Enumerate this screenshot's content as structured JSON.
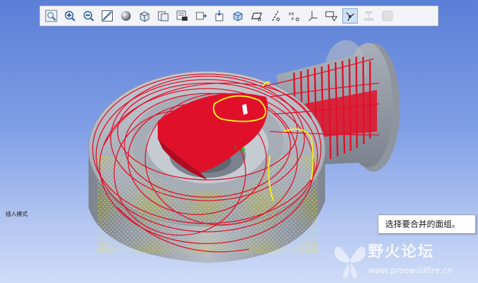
{
  "toolbar": {
    "buttons": [
      {
        "icon": "zoom-window-icon"
      },
      {
        "icon": "zoom-in-icon"
      },
      {
        "icon": "zoom-out-icon"
      },
      {
        "icon": "refit-icon"
      },
      {
        "icon": "shaded-sphere-icon"
      },
      {
        "icon": "view-cube-icon"
      },
      {
        "icon": "saved-views-icon"
      },
      {
        "icon": "layers-icon"
      },
      {
        "icon": "reorient-icon"
      },
      {
        "icon": "spin-center-icon"
      },
      {
        "icon": "display-style-icon"
      },
      {
        "icon": "datum-plane-icon"
      },
      {
        "icon": "datum-axis-icon"
      },
      {
        "icon": "datum-point-icon"
      },
      {
        "icon": "coordinate-system-icon"
      },
      {
        "icon": "annotation-icon"
      },
      {
        "icon": "selection-filter-icon",
        "active": true
      },
      {
        "icon": "feature-display-icon",
        "disabled": true
      },
      {
        "icon": "appearance-icon",
        "disabled": true
      }
    ]
  },
  "canvas": {
    "mode_label": "插入模式",
    "tooltip_text": "选择要合并的面组。"
  },
  "watermark": {
    "title": "野火论坛",
    "url": "www.proewildfire.cn"
  },
  "colors": {
    "background_top": "#5b7fd6",
    "background_bottom": "#cfdcf7",
    "model_gray": "#9aa1ac",
    "surface_red": "#e0102a",
    "highlight_yellow": "#f5ee20"
  }
}
